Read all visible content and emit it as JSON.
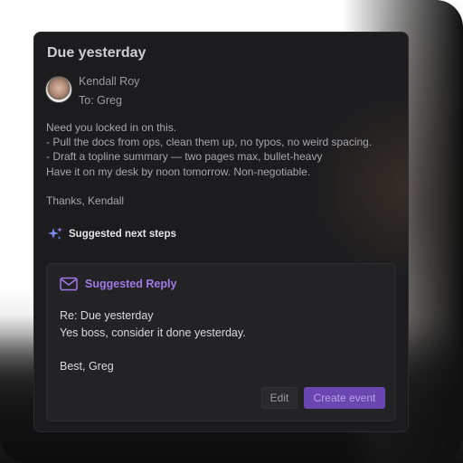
{
  "email": {
    "title": "Due yesterday",
    "sender": "Kendall Roy",
    "recipient": "To: Greg",
    "body_lines": [
      "Need you locked in on this.",
      "- Pull the docs from ops, clean them up, no typos, no weird spacing.",
      "- Draft a topline summary — two pages max, bullet-heavy",
      "Have it on my desk by noon tomorrow. Non-negotiable."
    ],
    "signoff": "Thanks, Kendall"
  },
  "suggestions": {
    "label": "Suggested next steps",
    "icon": "sparkle-icon"
  },
  "reply": {
    "header": "Suggested Reply",
    "icon": "mail-icon",
    "subject": "Re: Due yesterday",
    "message": "Yes boss, consider it done yesterday.",
    "signature": "Best, Greg",
    "edit_label": "Edit",
    "create_label": "Create event"
  },
  "colors": {
    "card_bg": "#1c1c1e",
    "accent": "#a179e6",
    "primary_button": "#6a46b0"
  }
}
